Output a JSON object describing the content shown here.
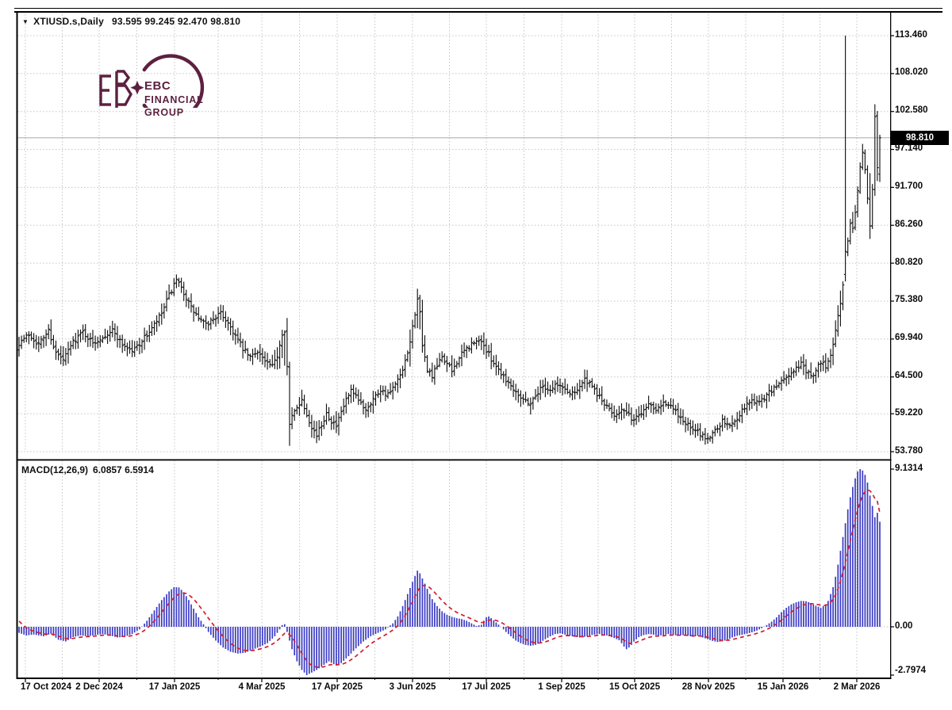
{
  "window": {
    "dropdown_icon": "▼",
    "symbol_title": "XTIUSD.s,Daily",
    "ohlc_line": "93.595 99.245 92.470 98.810"
  },
  "logo": {
    "line1": "EBC",
    "line2": "FINANCIAL",
    "line3": "GROUP"
  },
  "price_badge": "98.810",
  "macd_header": {
    "name": "MACD(12,26,9)",
    "values": "6.0857 6.5914"
  },
  "price_axis": {
    "labels": [
      "113.460",
      "108.020",
      "102.580",
      "97.140",
      "91.700",
      "86.260",
      "80.820",
      "75.380",
      "69.940",
      "64.500",
      "59.220",
      "53.780"
    ],
    "values": [
      113.46,
      108.02,
      102.58,
      97.14,
      91.7,
      86.26,
      80.82,
      75.38,
      69.94,
      64.5,
      59.22,
      53.78
    ]
  },
  "macd_axis": {
    "labels": [
      "9.1314",
      "0.00",
      "-2.7974"
    ],
    "values": [
      9.1314,
      0,
      -2.7974
    ]
  },
  "time_axis": {
    "labels": [
      "17 Oct 2024",
      "2 Dec 2024",
      "17 Jan 2025",
      "4 Mar 2025",
      "17 Apr 2025",
      "3 Jun 2025",
      "17 Jul 2025",
      "1 Sep 2025",
      "15 Oct 2025",
      "28 Nov 2025",
      "15 Jan 2026",
      "2 Mar 2026"
    ]
  },
  "colors": {
    "bar": "#141414",
    "macd_histogram": "#3b3bc4",
    "macd_signal": "#d21e2e",
    "grid": "#c4c4c4",
    "current_price_line": "#a8a8a8",
    "badge_bg": "#000000",
    "badge_text": "#ffffff",
    "logo": "#5d2040"
  },
  "chart_data": {
    "type": "ohlc-bar+macd-histogram",
    "symbol": "XTIUSD.s",
    "timeframe": "Daily",
    "last_quote": {
      "open": 93.595,
      "high": 99.245,
      "low": 92.47,
      "close": 98.81
    },
    "current_price": 98.81,
    "price_ylim": [
      53.78,
      113.46
    ],
    "macd_ylim": [
      -2.7974,
      9.1314
    ],
    "macd_current": 6.0857,
    "macd_signal_current": 6.5914,
    "bars": 351,
    "price_anchors": [
      [
        0,
        69.4
      ],
      [
        4,
        70.6
      ],
      [
        8,
        69.2
      ],
      [
        12,
        71.2
      ],
      [
        15,
        67.9
      ],
      [
        18,
        66.9
      ],
      [
        22,
        69.6
      ],
      [
        26,
        71.0
      ],
      [
        30,
        69.3
      ],
      [
        34,
        70.3
      ],
      [
        38,
        71.2
      ],
      [
        42,
        69.2
      ],
      [
        46,
        68.2
      ],
      [
        50,
        69.7
      ],
      [
        54,
        71.4
      ],
      [
        58,
        73.6
      ],
      [
        61,
        76.2
      ],
      [
        64,
        78.3
      ],
      [
        67,
        76.6
      ],
      [
        70,
        74.4
      ],
      [
        73,
        72.9
      ],
      [
        76,
        71.9
      ],
      [
        79,
        72.9
      ],
      [
        82,
        73.6
      ],
      [
        85,
        72.3
      ],
      [
        88,
        70.4
      ],
      [
        91,
        68.5
      ],
      [
        94,
        67.3
      ],
      [
        97,
        68.3
      ],
      [
        100,
        66.7
      ],
      [
        103,
        65.9
      ],
      [
        105,
        67.6
      ],
      [
        107,
        70.8
      ],
      [
        108,
        71.3
      ],
      [
        109,
        66.0
      ],
      [
        110,
        57.5
      ],
      [
        111,
        58.8
      ],
      [
        113,
        60.3
      ],
      [
        115,
        61.2
      ],
      [
        117,
        59.2
      ],
      [
        119,
        57.4
      ],
      [
        121,
        56.1
      ],
      [
        123,
        57.6
      ],
      [
        125,
        59.4
      ],
      [
        127,
        58.2
      ],
      [
        129,
        57.4
      ],
      [
        131,
        59.3
      ],
      [
        133,
        61.2
      ],
      [
        135,
        62.4
      ],
      [
        138,
        61.1
      ],
      [
        141,
        59.9
      ],
      [
        144,
        61.4
      ],
      [
        147,
        62.7
      ],
      [
        150,
        61.9
      ],
      [
        153,
        63.3
      ],
      [
        156,
        65.3
      ],
      [
        158,
        67.8
      ],
      [
        160,
        71.6
      ],
      [
        162,
        75.8
      ],
      [
        163,
        73.5
      ],
      [
        164,
        68.7
      ],
      [
        166,
        65.6
      ],
      [
        168,
        64.6
      ],
      [
        170,
        66.0
      ],
      [
        172,
        67.4
      ],
      [
        174,
        66.4
      ],
      [
        176,
        65.3
      ],
      [
        178,
        66.7
      ],
      [
        181,
        68.2
      ],
      [
        184,
        69.2
      ],
      [
        188,
        69.8
      ],
      [
        190,
        68.2
      ],
      [
        193,
        66.6
      ],
      [
        196,
        65.1
      ],
      [
        199,
        63.7
      ],
      [
        202,
        62.5
      ],
      [
        205,
        61.3
      ],
      [
        208,
        60.7
      ],
      [
        210,
        61.9
      ],
      [
        213,
        63.2
      ],
      [
        216,
        62.6
      ],
      [
        218,
        63.4
      ],
      [
        221,
        63.0
      ],
      [
        224,
        62.1
      ],
      [
        227,
        62.8
      ],
      [
        230,
        64.1
      ],
      [
        233,
        63.0
      ],
      [
        236,
        61.6
      ],
      [
        239,
        60.1
      ],
      [
        242,
        59.1
      ],
      [
        245,
        59.8
      ],
      [
        248,
        58.9
      ],
      [
        250,
        58.3
      ],
      [
        253,
        59.5
      ],
      [
        256,
        60.7
      ],
      [
        259,
        60.0
      ],
      [
        262,
        61.0
      ],
      [
        265,
        60.2
      ],
      [
        268,
        59.1
      ],
      [
        271,
        57.9
      ],
      [
        274,
        56.9
      ],
      [
        277,
        56.3
      ],
      [
        280,
        55.6
      ],
      [
        283,
        56.9
      ],
      [
        286,
        58.1
      ],
      [
        289,
        57.5
      ],
      [
        292,
        58.7
      ],
      [
        295,
        60.2
      ],
      [
        298,
        61.2
      ],
      [
        301,
        60.8
      ],
      [
        304,
        62.0
      ],
      [
        307,
        62.8
      ],
      [
        310,
        64.0
      ],
      [
        313,
        64.8
      ],
      [
        316,
        65.6
      ],
      [
        318,
        66.5
      ],
      [
        320,
        65.3
      ],
      [
        322,
        64.5
      ],
      [
        324,
        65.6
      ],
      [
        326,
        66.5
      ],
      [
        328,
        66.2
      ],
      [
        330,
        67.6
      ],
      [
        331,
        69.2
      ],
      [
        332,
        71.3
      ],
      [
        333,
        73.3
      ],
      [
        334,
        75.2
      ],
      [
        335,
        77.6
      ],
      [
        336,
        82.5
      ],
      [
        337,
        84.0
      ],
      [
        338,
        86.5
      ],
      [
        339,
        85.8
      ],
      [
        340,
        88.2
      ],
      [
        341,
        91.2
      ],
      [
        342,
        94.6
      ],
      [
        343,
        96.8
      ],
      [
        344,
        94.2
      ],
      [
        345,
        90.2
      ],
      [
        346,
        86.2
      ],
      [
        347,
        91.5
      ],
      [
        348,
        101.8
      ],
      [
        349,
        94.5
      ],
      [
        350,
        98.81
      ]
    ],
    "price_specials": {
      "64": {
        "high": 79.2
      },
      "110": {
        "low": 54.62
      },
      "121": {
        "low": 55.0
      },
      "162": {
        "high": 77.15
      },
      "280": {
        "low": 54.9
      },
      "336": {
        "open": 79.2,
        "close": 82.5,
        "high": 113.46,
        "low": 78.2
      },
      "346": {
        "low": 84.3
      },
      "348": {
        "high": 103.62
      },
      "349": {
        "low": 92.6
      },
      "350": {
        "open": 93.595,
        "high": 99.245,
        "low": 92.47,
        "close": 98.81
      }
    },
    "macd_anchors": [
      [
        0,
        -0.35
      ],
      [
        3,
        -0.5
      ],
      [
        6,
        -0.45
      ],
      [
        10,
        -0.55
      ],
      [
        13,
        -0.4
      ],
      [
        16,
        -0.75
      ],
      [
        19,
        -0.85
      ],
      [
        22,
        -0.6
      ],
      [
        25,
        -0.5
      ],
      [
        28,
        -0.55
      ],
      [
        31,
        -0.48
      ],
      [
        34,
        -0.42
      ],
      [
        37,
        -0.5
      ],
      [
        40,
        -0.62
      ],
      [
        43,
        -0.58
      ],
      [
        46,
        -0.42
      ],
      [
        49,
        -0.15
      ],
      [
        52,
        0.35
      ],
      [
        55,
        0.95
      ],
      [
        58,
        1.55
      ],
      [
        61,
        2.05
      ],
      [
        63,
        2.3
      ],
      [
        65,
        2.28
      ],
      [
        67,
        2.0
      ],
      [
        69,
        1.55
      ],
      [
        71,
        1.05
      ],
      [
        73,
        0.55
      ],
      [
        75,
        0.15
      ],
      [
        77,
        -0.3
      ],
      [
        80,
        -0.8
      ],
      [
        83,
        -1.2
      ],
      [
        86,
        -1.45
      ],
      [
        89,
        -1.55
      ],
      [
        92,
        -1.5
      ],
      [
        95,
        -1.32
      ],
      [
        98,
        -1.15
      ],
      [
        101,
        -0.95
      ],
      [
        104,
        -0.55
      ],
      [
        106,
        -0.15
      ],
      [
        107,
        0.1
      ],
      [
        108,
        0.15
      ],
      [
        109,
        -0.3
      ],
      [
        111,
        -1.3
      ],
      [
        113,
        -2.0
      ],
      [
        115,
        -2.5
      ],
      [
        117,
        -2.7974
      ],
      [
        119,
        -2.65
      ],
      [
        121,
        -2.5
      ],
      [
        123,
        -2.3
      ],
      [
        126,
        -2.0
      ],
      [
        129,
        -2.25
      ],
      [
        131,
        -2.1
      ],
      [
        134,
        -1.7
      ],
      [
        137,
        -1.25
      ],
      [
        140,
        -0.85
      ],
      [
        143,
        -0.55
      ],
      [
        146,
        -0.35
      ],
      [
        149,
        -0.15
      ],
      [
        152,
        0.2
      ],
      [
        154,
        0.6
      ],
      [
        156,
        1.2
      ],
      [
        158,
        1.9
      ],
      [
        160,
        2.6
      ],
      [
        161,
        2.95
      ],
      [
        162,
        3.25
      ],
      [
        163,
        3.1
      ],
      [
        164,
        2.8
      ],
      [
        166,
        2.2
      ],
      [
        168,
        1.6
      ],
      [
        170,
        1.2
      ],
      [
        172,
        0.9
      ],
      [
        174,
        0.7
      ],
      [
        176,
        0.58
      ],
      [
        178,
        0.5
      ],
      [
        180,
        0.45
      ],
      [
        182,
        0.35
      ],
      [
        184,
        0.2
      ],
      [
        186,
        0.05
      ],
      [
        188,
        0.12
      ],
      [
        189,
        0.35
      ],
      [
        190,
        0.55
      ],
      [
        191,
        0.6
      ],
      [
        192,
        0.5
      ],
      [
        194,
        0.25
      ],
      [
        196,
        0.0
      ],
      [
        198,
        -0.3
      ],
      [
        200,
        -0.55
      ],
      [
        202,
        -0.8
      ],
      [
        204,
        -0.95
      ],
      [
        206,
        -1.05
      ],
      [
        208,
        -1.1
      ],
      [
        210,
        -1.05
      ],
      [
        212,
        -0.9
      ],
      [
        214,
        -0.72
      ],
      [
        216,
        -0.55
      ],
      [
        218,
        -0.42
      ],
      [
        220,
        -0.38
      ],
      [
        222,
        -0.45
      ],
      [
        224,
        -0.52
      ],
      [
        226,
        -0.58
      ],
      [
        228,
        -0.62
      ],
      [
        230,
        -0.58
      ],
      [
        232,
        -0.5
      ],
      [
        234,
        -0.45
      ],
      [
        236,
        -0.42
      ],
      [
        238,
        -0.46
      ],
      [
        240,
        -0.55
      ],
      [
        242,
        -0.65
      ],
      [
        244,
        -0.78
      ],
      [
        245,
        -0.95
      ],
      [
        246,
        -1.15
      ],
      [
        247,
        -1.3
      ],
      [
        248,
        -1.2
      ],
      [
        249,
        -1.05
      ],
      [
        250,
        -0.85
      ],
      [
        252,
        -0.6
      ],
      [
        254,
        -0.48
      ],
      [
        256,
        -0.42
      ],
      [
        258,
        -0.46
      ],
      [
        260,
        -0.52
      ],
      [
        262,
        -0.48
      ],
      [
        264,
        -0.42
      ],
      [
        266,
        -0.46
      ],
      [
        268,
        -0.52
      ],
      [
        270,
        -0.48
      ],
      [
        272,
        -0.52
      ],
      [
        274,
        -0.58
      ],
      [
        276,
        -0.52
      ],
      [
        278,
        -0.62
      ],
      [
        280,
        -0.72
      ],
      [
        282,
        -0.82
      ],
      [
        284,
        -0.88
      ],
      [
        286,
        -0.85
      ],
      [
        288,
        -0.75
      ],
      [
        290,
        -0.62
      ],
      [
        292,
        -0.52
      ],
      [
        294,
        -0.46
      ],
      [
        296,
        -0.4
      ],
      [
        298,
        -0.32
      ],
      [
        300,
        -0.22
      ],
      [
        302,
        -0.08
      ],
      [
        304,
        0.1
      ],
      [
        306,
        0.3
      ],
      [
        308,
        0.55
      ],
      [
        310,
        0.85
      ],
      [
        312,
        1.1
      ],
      [
        314,
        1.3
      ],
      [
        316,
        1.42
      ],
      [
        318,
        1.5
      ],
      [
        320,
        1.48
      ],
      [
        322,
        1.38
      ],
      [
        324,
        1.22
      ],
      [
        326,
        1.1
      ],
      [
        328,
        1.3
      ],
      [
        329,
        1.5
      ],
      [
        330,
        1.9
      ],
      [
        331,
        2.3
      ],
      [
        332,
        2.9
      ],
      [
        333,
        3.6
      ],
      [
        334,
        4.4
      ],
      [
        335,
        5.2
      ],
      [
        336,
        6.0
      ],
      [
        337,
        6.8
      ],
      [
        338,
        7.5
      ],
      [
        339,
        8.1
      ],
      [
        340,
        8.6
      ],
      [
        341,
        9.0
      ],
      [
        342,
        9.1314
      ],
      [
        343,
        9.05
      ],
      [
        344,
        8.8
      ],
      [
        345,
        8.35
      ],
      [
        346,
        7.6
      ],
      [
        347,
        7.0
      ],
      [
        348,
        6.35
      ],
      [
        349,
        6.6
      ],
      [
        350,
        6.0857
      ]
    ],
    "grid": true,
    "legend_position": "none"
  }
}
